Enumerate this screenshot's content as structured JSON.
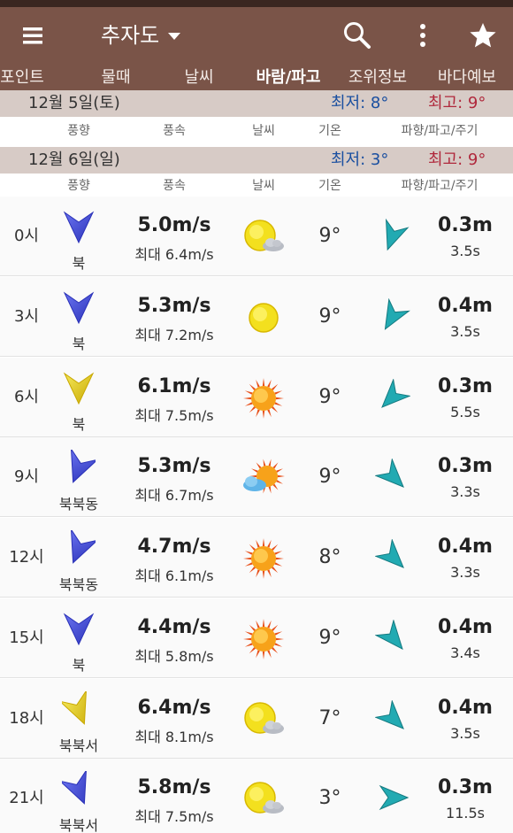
{
  "app": {
    "title": "추자도"
  },
  "colors": {
    "appbar": "#7a5448",
    "daybar": "#d7cbc6",
    "min_temp": "#1a4fa0",
    "max_temp": "#b0283c",
    "wind_blue": "#3b45d6",
    "wind_yellow": "#e8d020",
    "wave_teal": "#20a8b0"
  },
  "icons": {
    "menu": "menu-icon",
    "dropdown": "chevron-down-icon",
    "search": "search-icon",
    "more": "more-vert-icon",
    "favorite": "star-icon"
  },
  "tabs": [
    {
      "label": "포인트"
    },
    {
      "label": "물때"
    },
    {
      "label": "날씨"
    },
    {
      "label": "바람/파고",
      "active": true
    },
    {
      "label": "조위정보"
    },
    {
      "label": "바다예보"
    }
  ],
  "columns": {
    "wind_dir": "풍향",
    "wind_speed": "풍속",
    "weather": "날씨",
    "temp": "기온",
    "wave": "파향/파고/주기"
  },
  "days": [
    {
      "date": "12월 5일(토)",
      "min": "최저: 8°",
      "max": "최고: 9°"
    },
    {
      "date": "12월 6일(일)",
      "min": "최저: 3°",
      "max": "최고: 9°"
    }
  ],
  "rows": [
    {
      "hour": "0시",
      "wind_dir": "북",
      "wind_deg": 0,
      "wind_color": "blue",
      "speed": "5.0m/s",
      "gust": "최대 6.4m/s",
      "weather": "partly-cloudy",
      "temp": "9°",
      "wave_deg": 200,
      "wave_height": "0.3m",
      "wave_period": "3.5s"
    },
    {
      "hour": "3시",
      "wind_dir": "북",
      "wind_deg": 0,
      "wind_color": "blue",
      "speed": "5.3m/s",
      "gust": "최대 7.2m/s",
      "weather": "clear-moon",
      "temp": "9°",
      "wave_deg": 210,
      "wave_height": "0.4m",
      "wave_period": "3.5s"
    },
    {
      "hour": "6시",
      "wind_dir": "북",
      "wind_deg": 0,
      "wind_color": "yellow",
      "speed": "6.1m/s",
      "gust": "최대 7.5m/s",
      "weather": "sunny",
      "temp": "9°",
      "wave_deg": 225,
      "wave_height": "0.3m",
      "wave_period": "5.5s"
    },
    {
      "hour": "9시",
      "wind_dir": "북북동",
      "wind_deg": 22,
      "wind_color": "blue",
      "speed": "5.3m/s",
      "gust": "최대 6.7m/s",
      "weather": "sun-cloud",
      "temp": "9°",
      "wave_deg": 135,
      "wave_height": "0.3m",
      "wave_period": "3.3s"
    },
    {
      "hour": "12시",
      "wind_dir": "북북동",
      "wind_deg": 22,
      "wind_color": "blue",
      "speed": "4.7m/s",
      "gust": "최대 6.1m/s",
      "weather": "sunny",
      "temp": "8°",
      "wave_deg": 135,
      "wave_height": "0.4m",
      "wave_period": "3.3s"
    },
    {
      "hour": "15시",
      "wind_dir": "북",
      "wind_deg": 0,
      "wind_color": "blue",
      "speed": "4.4m/s",
      "gust": "최대 5.8m/s",
      "weather": "sunny",
      "temp": "9°",
      "wave_deg": 140,
      "wave_height": "0.4m",
      "wave_period": "3.4s"
    },
    {
      "hour": "18시",
      "wind_dir": "북북서",
      "wind_deg": -22,
      "wind_color": "yellow",
      "speed": "6.4m/s",
      "gust": "최대 8.1m/s",
      "weather": "partly-cloudy",
      "temp": "7°",
      "wave_deg": 135,
      "wave_height": "0.4m",
      "wave_period": "3.5s"
    },
    {
      "hour": "21시",
      "wind_dir": "북북서",
      "wind_deg": -22,
      "wind_color": "blue",
      "speed": "5.8m/s",
      "gust": "최대 7.5m/s",
      "weather": "partly-cloudy",
      "temp": "3°",
      "wave_deg": 90,
      "wave_height": "0.3m",
      "wave_period": "11.5s"
    }
  ]
}
